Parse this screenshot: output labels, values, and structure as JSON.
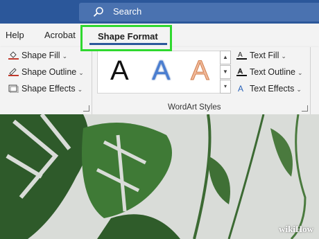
{
  "search": {
    "label": "Search"
  },
  "tabs": {
    "help": "Help",
    "acrobat": "Acrobat",
    "shape_format": "Shape Format"
  },
  "shape_styles": {
    "fill": "Shape Fill",
    "outline": "Shape Outline",
    "effects": "Shape Effects"
  },
  "wordart": {
    "group_title": "WordArt Styles",
    "sample_glyph": "A",
    "text_fill": "Text Fill",
    "text_outline": "Text Outline",
    "text_effects": "Text Effects"
  },
  "watermark": "wikiHow",
  "colors": {
    "title_bar": "#2b579a",
    "highlight": "#2fd82f",
    "ribbon": "#f3f3f3"
  }
}
